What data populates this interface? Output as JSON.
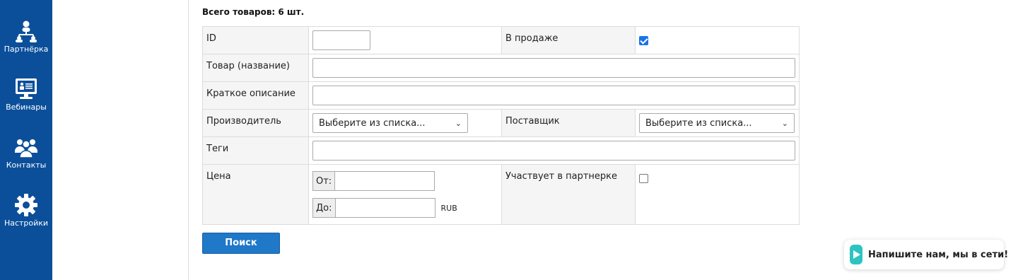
{
  "sidebar": {
    "items": [
      {
        "label": "Партнёрка",
        "icon": "partner-network-icon"
      },
      {
        "label": "Вебинары",
        "icon": "webinar-screen-icon"
      },
      {
        "label": "Контакты",
        "icon": "contacts-group-icon"
      },
      {
        "label": "Настройки",
        "icon": "gear-icon"
      }
    ]
  },
  "total_label": "Всего товаров: 6 шт.",
  "filters": {
    "id_label": "ID",
    "id_value": "",
    "on_sale_label": "В продаже",
    "on_sale_checked": true,
    "product_label": "Товар (название)",
    "product_value": "",
    "short_desc_label": "Краткое описание",
    "short_desc_value": "",
    "manufacturer_label": "Производитель",
    "manufacturer_selected": "Выберите из списка...",
    "supplier_label": "Поставщик",
    "supplier_selected": "Выберите из списка...",
    "tags_label": "Теги",
    "tags_value": "",
    "price_label": "Цена",
    "price_from_prefix": "От:",
    "price_to_prefix": "До:",
    "price_from_value": "",
    "price_to_value": "",
    "currency": "RUB",
    "affiliate_label": "Участвует в партнерке",
    "affiliate_checked": false
  },
  "search_button": "Поиск",
  "chat_widget": {
    "text": "Напишите нам, мы в сети!",
    "color": "#2cc4c0"
  },
  "colors": {
    "sidebar": "#0b4f9a",
    "button": "#1f78c8"
  }
}
